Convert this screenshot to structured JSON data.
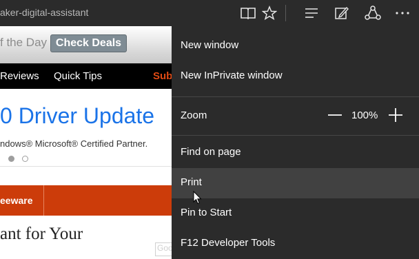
{
  "topbar": {
    "url_text": "aker-digital-assistant",
    "icons": [
      "reading-view-icon",
      "favorite-star-icon",
      "hub-icon",
      "web-note-icon",
      "share-icon",
      "more-icon"
    ]
  },
  "page": {
    "deals_prefix": "f the Day",
    "deals_button": "Check Deals",
    "nav": {
      "reviews": "Reviews",
      "quick_tips": "Quick Tips",
      "partial": "Sub"
    },
    "headline": "0 Driver Update",
    "subtitle": "ndows® Microsoft® Certified Partner.",
    "orange_text": "eeware",
    "bottom_text": "ant for Your",
    "google_badge": "Goo"
  },
  "menu": {
    "new_window": "New window",
    "new_private": "New InPrivate window",
    "zoom_label": "Zoom",
    "zoom_value": "100%",
    "find_on_page": "Find on page",
    "print": "Print",
    "pin_to_start": "Pin to Start",
    "dev_tools": "F12 Developer Tools"
  },
  "colors": {
    "chrome": "#2b2b2b",
    "highlight": "#414141",
    "headline": "#1a73e8",
    "orange": "#cc3c0a"
  }
}
